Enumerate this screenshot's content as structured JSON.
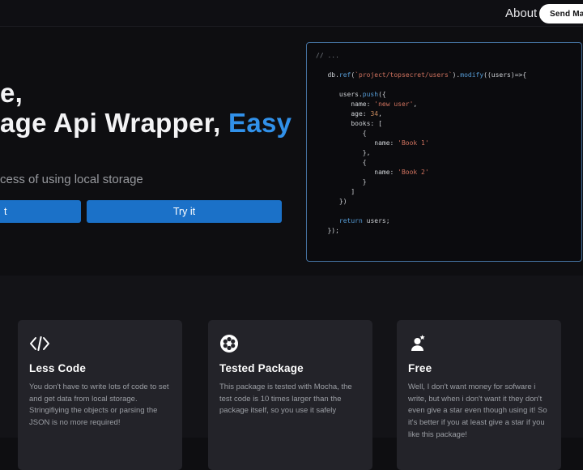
{
  "colors": {
    "accent_blue": "#1b71c8",
    "heading_accent": "#3191ea",
    "code_border": "#44719f"
  },
  "navbar": {
    "about": "About",
    "send_mail": "Send Mail"
  },
  "hero": {
    "heading_line1_fragment": "e,",
    "heading_line2_fragment": "age Api Wrapper, ",
    "heading_highlight": "Easy",
    "subtitle_fragment": "cess of using local storage",
    "primary_button_fragment": "t",
    "try_button": "Try it"
  },
  "code_panel": {
    "lines": [
      [
        {
          "c": "cm",
          "t": "// ..."
        }
      ],
      [],
      [
        {
          "c": "pl",
          "t": "   db."
        },
        {
          "c": "fn",
          "t": "ref"
        },
        {
          "c": "pl",
          "t": "("
        },
        {
          "c": "st",
          "t": "`project/topsecret/users`"
        },
        {
          "c": "pl",
          "t": ")."
        },
        {
          "c": "fn",
          "t": "modify"
        },
        {
          "c": "pl",
          "t": "((users)=>{"
        }
      ],
      [],
      [
        {
          "c": "pl",
          "t": "      users."
        },
        {
          "c": "fn",
          "t": "push"
        },
        {
          "c": "pl",
          "t": "({"
        }
      ],
      [
        {
          "c": "pl",
          "t": "         name: "
        },
        {
          "c": "st",
          "t": "'new user'"
        },
        {
          "c": "pl",
          "t": ","
        }
      ],
      [
        {
          "c": "pl",
          "t": "         age: "
        },
        {
          "c": "nu",
          "t": "34"
        },
        {
          "c": "pl",
          "t": ","
        }
      ],
      [
        {
          "c": "pl",
          "t": "         books: ["
        }
      ],
      [
        {
          "c": "pl",
          "t": "            {"
        }
      ],
      [
        {
          "c": "pl",
          "t": "               name: "
        },
        {
          "c": "st",
          "t": "'Book 1'"
        }
      ],
      [
        {
          "c": "pl",
          "t": "            },"
        }
      ],
      [
        {
          "c": "pl",
          "t": "            {"
        }
      ],
      [
        {
          "c": "pl",
          "t": "               name: "
        },
        {
          "c": "st",
          "t": "'Book 2'"
        }
      ],
      [
        {
          "c": "pl",
          "t": "            }"
        }
      ],
      [
        {
          "c": "pl",
          "t": "         ]"
        }
      ],
      [
        {
          "c": "pl",
          "t": "      })"
        }
      ],
      [],
      [
        {
          "c": "pl",
          "t": "      "
        },
        {
          "c": "kw",
          "t": "return"
        },
        {
          "c": "pl",
          "t": " users;"
        }
      ],
      [
        {
          "c": "pl",
          "t": "   });"
        }
      ]
    ]
  },
  "features": {
    "cards": [
      {
        "icon": "code-icon",
        "title": "Less Code",
        "body": "You don't have to write lots of code to set and get data from local storage. Stringifiying the objects or parsing the JSON is no more required!"
      },
      {
        "icon": "flower-badge-icon",
        "title": "Tested Package",
        "body": "This package is tested with Mocha, the test code is 10 times larger than the package itself, so you use it safely"
      },
      {
        "icon": "user-star-icon",
        "title": "Free",
        "body": "Well, I don't want money for sofware i write, but when i don't want it they don't even give a star even though using it! So it's better if you at least give a star if you like this package!"
      }
    ]
  }
}
